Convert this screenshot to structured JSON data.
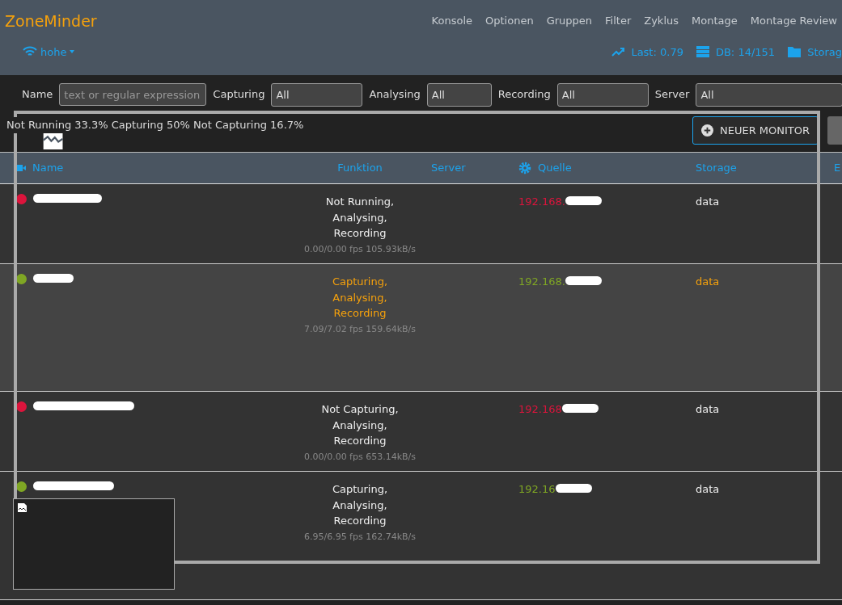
{
  "navbar": {
    "brand": "ZoneMinder",
    "links": [
      "Konsole",
      "Optionen",
      "Gruppen",
      "Filter",
      "Zyklus",
      "Montage",
      "Montage Review"
    ],
    "group_menu": "hohe",
    "stats": [
      {
        "kind": "load",
        "text": "Last: 0.79"
      },
      {
        "kind": "db",
        "text": "DB: 14/151"
      },
      {
        "kind": "storage",
        "text": "Storag"
      }
    ]
  },
  "filters": [
    {
      "label": "Name",
      "placeholder": "text or regular expression"
    },
    {
      "label": "Capturing",
      "value": "All"
    },
    {
      "label": "Analysing",
      "value": "All"
    },
    {
      "label": "Recording",
      "value": "All"
    },
    {
      "label": "Server",
      "value": "All"
    }
  ],
  "summary": "Not Running 33.3% Capturing 50% Not Capturing 16.7%",
  "buttons": [
    {
      "kind": "add",
      "label": "NEUER MONITOR"
    },
    {
      "kind": "edit"
    }
  ],
  "table": {
    "columns": [
      {
        "kind": "name",
        "label": "Name"
      },
      {
        "kind": "function",
        "label": "Funktion"
      },
      {
        "kind": "server",
        "label": "Server"
      },
      {
        "kind": "source",
        "label": "Quelle"
      },
      {
        "kind": "storage",
        "label": "Storage"
      },
      {
        "kind": "plain",
        "label": "E"
      }
    ],
    "rows": [
      {
        "color": "#dc143c",
        "highlighted": false,
        "function": [
          "Not Running,",
          "Analysing,",
          "Recording"
        ],
        "rate": "0.00/0.00 fps 105.93kB/s",
        "source": "192.168.",
        "storage": "data"
      },
      {
        "color": "#7fa624",
        "highlighted": true,
        "function": [
          "Capturing,",
          "Analysing,",
          "Recording"
        ],
        "rate": "7.09/7.02 fps 159.64kB/s",
        "source": "192.168.",
        "storage": "data"
      },
      {
        "color": "#dc143c",
        "highlighted": false,
        "function": [
          "Not Capturing,",
          "Analysing,",
          "Recording"
        ],
        "rate": "0.00/0.00 fps 653.14kB/s",
        "source": "192.168",
        "storage": "data"
      },
      {
        "color": "#7fa624",
        "highlighted": false,
        "function": [
          "Capturing,",
          "Analysing,",
          "Recording"
        ],
        "rate": "6.95/6.95 fps 162.74kB/s",
        "source": "192.16",
        "storage": "data"
      }
    ]
  }
}
